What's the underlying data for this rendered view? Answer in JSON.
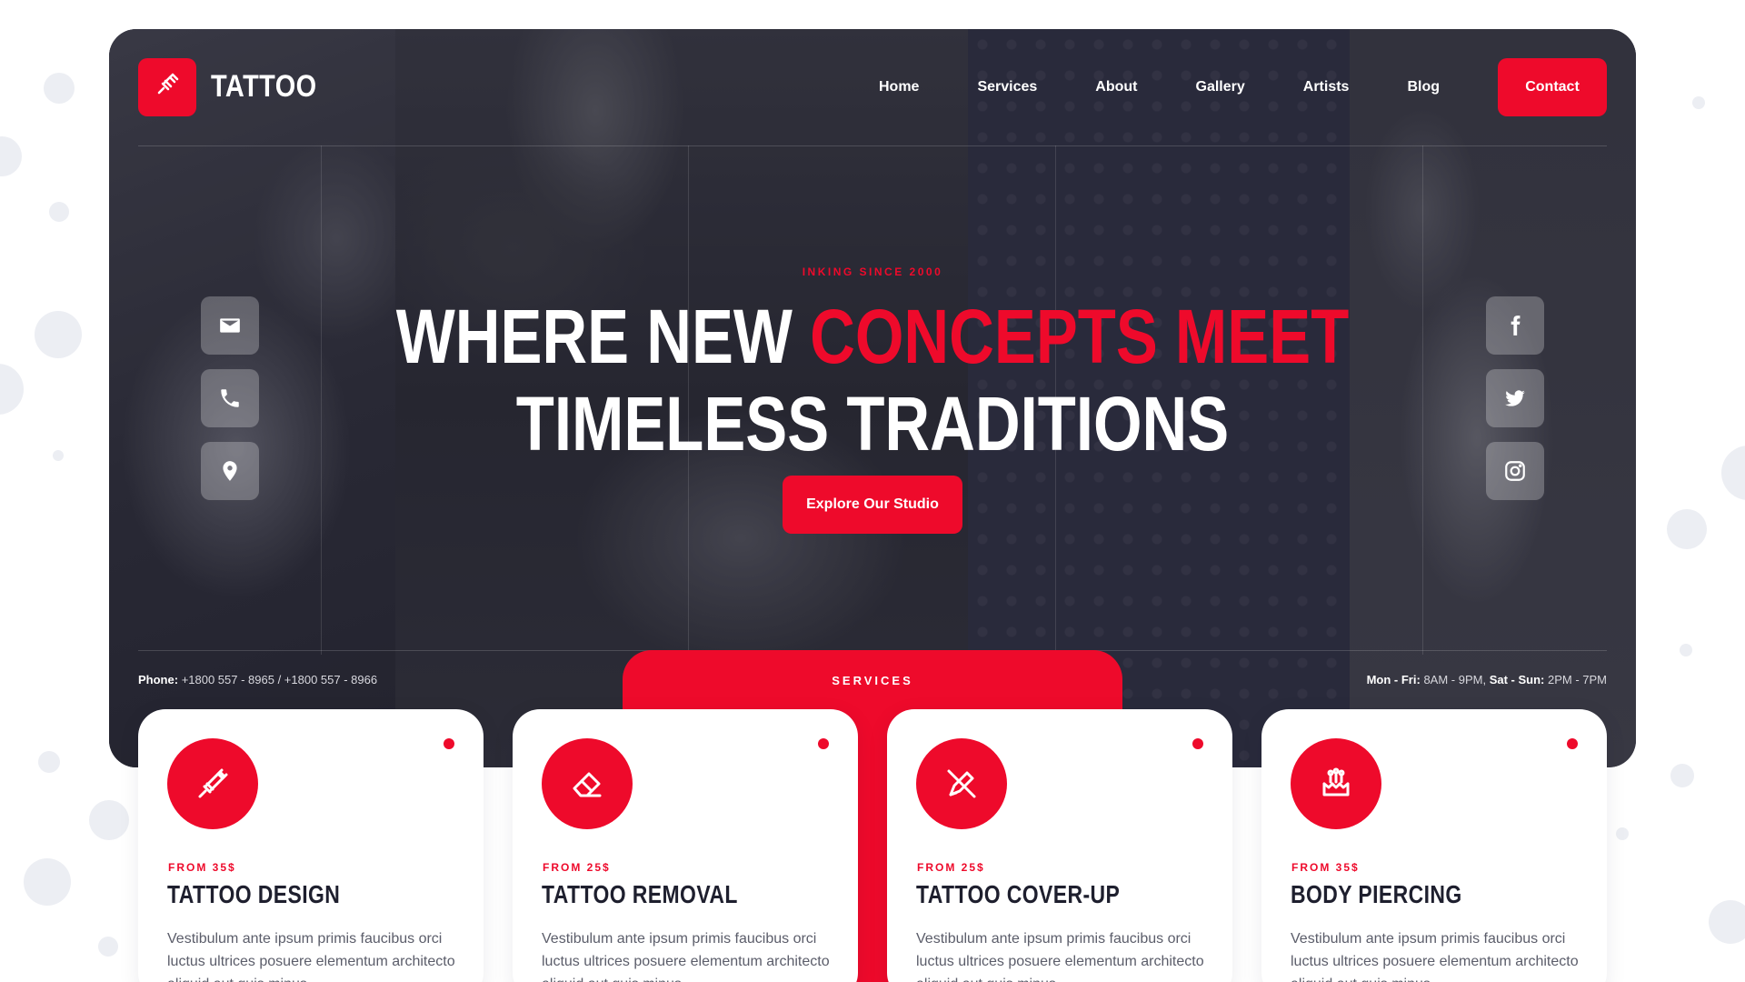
{
  "brand": {
    "name": "TATTOO",
    "logo_icon": "tattoo-machine-icon"
  },
  "nav": {
    "items": [
      "Home",
      "Services",
      "About",
      "Gallery",
      "Artists",
      "Blog"
    ],
    "contact_label": "Contact"
  },
  "hero": {
    "tagline": "INKING SINCE 2000",
    "headline_white_1": "WHERE NEW ",
    "headline_red": "CONCEPTS MEET",
    "headline_white_2": "TIMELESS TRADITIONS",
    "cta_label": "Explore Our Studio"
  },
  "contact_icons": [
    "envelope-icon",
    "phone-icon",
    "map-pin-icon"
  ],
  "social_icons": [
    "facebook-icon",
    "twitter-icon",
    "instagram-icon"
  ],
  "footer_info": {
    "phone_label": "Phone:",
    "phone_value": "+1800 557 - 8965 / +1800 557 - 8966",
    "hours_label_1": "Mon - Fri:",
    "hours_value_1": "8AM - 9PM,",
    "hours_label_2": "Sat - Sun:",
    "hours_value_2": "2PM - 7PM"
  },
  "services": {
    "label": "SERVICES",
    "cards": [
      {
        "price": "FROM 35$",
        "title": "TATTOO DESIGN",
        "icon": "tattoo-machine-icon",
        "desc": "Vestibulum ante ipsum primis faucibus orci luctus ultrices posuere elementum architecto aliquid aut quis minus"
      },
      {
        "price": "FROM 25$",
        "title": "TATTOO REMOVAL",
        "icon": "eraser-icon",
        "desc": "Vestibulum ante ipsum primis faucibus orci luctus ultrices posuere elementum architecto aliquid aut quis minus"
      },
      {
        "price": "FROM 25$",
        "title": "TATTOO COVER-UP",
        "icon": "pen-slash-icon",
        "desc": "Vestibulum ante ipsum primis faucibus orci luctus ultrices posuere elementum architecto aliquid aut quis minus"
      },
      {
        "price": "FROM 35$",
        "title": "BODY PIERCING",
        "icon": "piercing-icon",
        "desc": "Vestibulum ante ipsum primis faucibus orci luctus ultrices posuere elementum architecto aliquid aut quis minus"
      }
    ]
  },
  "colors": {
    "accent": "#ee0a2b",
    "dark": "#1e1f2e",
    "text_muted": "#5b5d6a"
  }
}
